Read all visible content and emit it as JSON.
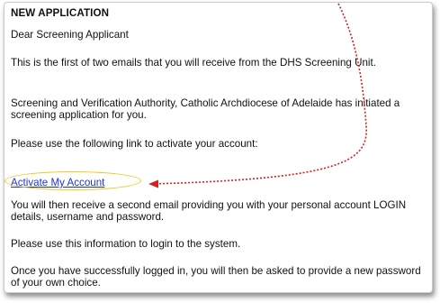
{
  "email": {
    "heading": "NEW APPLICATION",
    "greeting": "Dear Screening Applicant",
    "para1": "This is the first of two emails that you will receive from the DHS Screening Unit.",
    "para2": "Screening and Verification Authority, Catholic Archdiocese of Adelaide has initiated a screening application for you.",
    "para3": "Please use the following link to activate your account:",
    "link_label": "Activate My Account",
    "para4": "You will then receive a second email providing you with your personal account LOGIN details, username and password.",
    "para5": "Please use this information to login to the system.",
    "para6": "Once you have successfully logged in, you will then be asked to provide a new password of your own choice."
  },
  "annotation": {
    "highlight_color": "#f0c419",
    "arrow_color": "#d42020"
  }
}
